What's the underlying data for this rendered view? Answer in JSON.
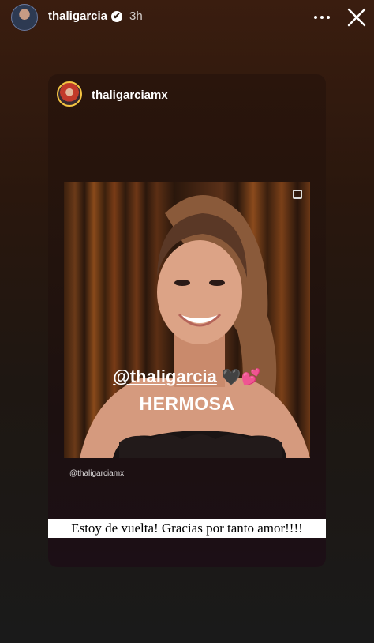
{
  "header": {
    "username": "thaligarcia",
    "verified_glyph": "✔",
    "time": "3h",
    "more_icon": "more-horizontal-icon",
    "close_icon": "close-icon"
  },
  "shared_post": {
    "author": "thaligarciamx",
    "mention": "@thaligarcia",
    "hearts": "🖤💕",
    "word": "HERMOSA",
    "handle_watermark": "@thaligarciamx"
  },
  "caption": "Estoy de vuelta! Gracias por tanto amor!!!!",
  "colors": {
    "background_top": "#3a1d0f",
    "background_bottom": "#1a1a1a",
    "caption_bg": "#ffffff"
  }
}
